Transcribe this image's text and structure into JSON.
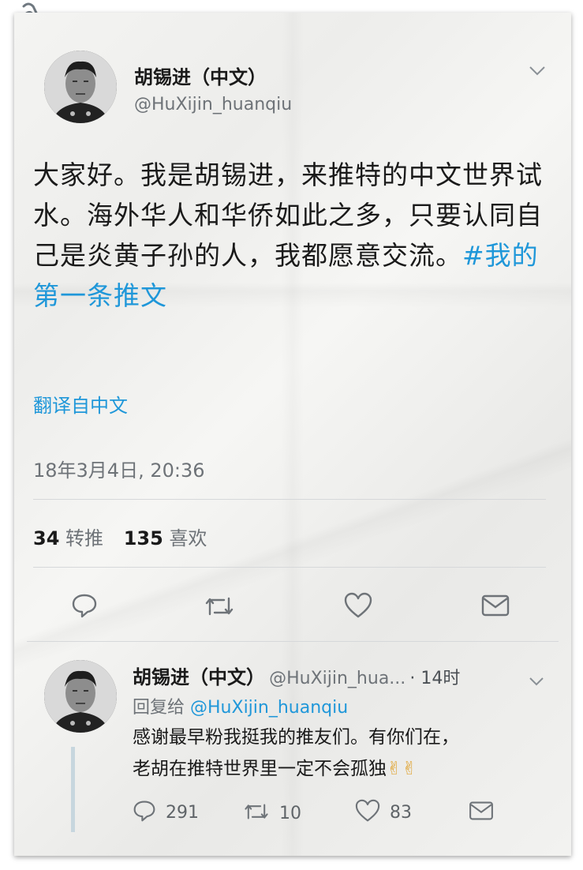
{
  "tweet": {
    "display_name": "胡锡进（中文）",
    "handle": "@HuXijin_huanqiu",
    "text": "大家好。我是胡锡进，来推特的中文世界试水。海外华人和华侨如此之多，只要认同自己是炎黄子孙的人，我都愿意交流。",
    "hashtag": "#我的第一条推文",
    "translate_label": "翻译自中文",
    "timestamp": "18年3月4日, 20:36",
    "retweets_count": "34",
    "retweets_label": "转推",
    "likes_count": "135",
    "likes_label": "喜欢"
  },
  "reply": {
    "display_name": "胡锡进（中文）",
    "handle": "@HuXijin_hua...",
    "time": "· 14时",
    "reply_to_prefix": "回复给",
    "reply_to_handle": "@HuXijin_huanqiu",
    "text_line1": "感谢最早粉我挺我的推友们。有你们在，",
    "text_line2": "老胡在推特世界里一定不会孤独",
    "emoji": "✌✌",
    "reply_count": "291",
    "retweet_count": "10",
    "like_count": "83"
  },
  "icons": [
    "paperclip-icon",
    "chevron-down-icon",
    "reply-icon",
    "retweet-icon",
    "like-icon",
    "share-icon"
  ],
  "colors": {
    "link": "#1f97d9",
    "muted": "#6e7378"
  }
}
